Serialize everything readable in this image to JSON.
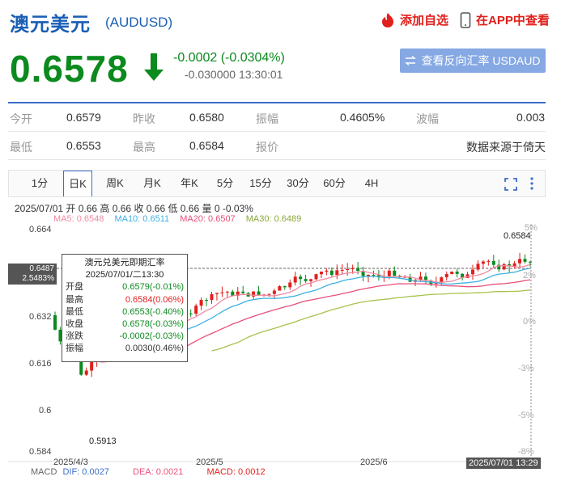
{
  "header": {
    "title": "澳元美元",
    "code": "(AUDUSD)",
    "add_watch": "添加自选",
    "view_app": "在APP中查看"
  },
  "quote": {
    "price": "0.6578",
    "change": "-0.0002 (-0.0304%)",
    "sub": "-0.030000 13:30:01",
    "reverse_button": "查看反向汇率 USDAUD"
  },
  "stats": {
    "open_label": "今开",
    "open": "0.6579",
    "prev_label": "昨收",
    "prev": "0.6580",
    "amp_label": "振幅",
    "amp": "0.4605%",
    "wave_label": "波幅",
    "wave": "0.003",
    "low_label": "最低",
    "low": "0.6553",
    "high_label": "最高",
    "high": "0.6584",
    "quote_label": "报价",
    "source": "数据来源于倚天"
  },
  "tabs": [
    "1分",
    "日K",
    "周K",
    "月K",
    "年K",
    "5分",
    "15分",
    "30分",
    "60分",
    "4H"
  ],
  "chart_info": {
    "line1": "2025/07/01 开 0.66 高 0.66 收 0.66 低 0.66 量 0 -0.03%",
    "ma5": "MA5: 0.6548",
    "ma10": "MA10: 0.6511",
    "ma20": "MA20: 0.6507",
    "ma30": "MA30: 0.6489"
  },
  "tooltip": {
    "title": "澳元兑美元即期汇率",
    "date": "2025/07/01/二13:30",
    "rows": [
      {
        "label": "开盘",
        "value": "0.6579(-0.01%)",
        "color": "#0b8a1e"
      },
      {
        "label": "最高",
        "value": "0.6584(0.06%)",
        "color": "#e0201c"
      },
      {
        "label": "最低",
        "value": "0.6553(-0.40%)",
        "color": "#0b8a1e"
      },
      {
        "label": "收盘",
        "value": "0.6578(-0.03%)",
        "color": "#0b8a1e"
      },
      {
        "label": "涨跌",
        "value": "-0.0002(-0.03%)",
        "color": "#0b8a1e"
      },
      {
        "label": "振幅",
        "value": "0.0030(0.46%)",
        "color": "#333333"
      }
    ]
  },
  "axis": {
    "y_labels": [
      "0.664",
      "0.648",
      "0.632",
      "0.616",
      "0.6",
      "0.584"
    ],
    "y_right": [
      "5%",
      "2%",
      "0%",
      "-3%",
      "-5%",
      "-8%"
    ],
    "x_labels": [
      "2025/4/3",
      "2025/5",
      "2025/6"
    ],
    "cursor_price": "0.6487",
    "cursor_pct": "2.5483%",
    "cursor_date": "2025/07/01 13:29",
    "high_mark": "0.6584",
    "low_mark": "0.5913"
  },
  "macd": {
    "label": "MACD",
    "dif": "DIF: 0.0027",
    "dea": "DEA: 0.0021",
    "macd": "MACD: 0.0012"
  },
  "colors": {
    "up": "#e0201c",
    "down": "#0b8a1e",
    "ma5": "#f08aa0",
    "ma10": "#3fb0e0",
    "ma20": "#e8507a",
    "ma30": "#a6c24a",
    "accent": "#1a5fb4"
  }
}
